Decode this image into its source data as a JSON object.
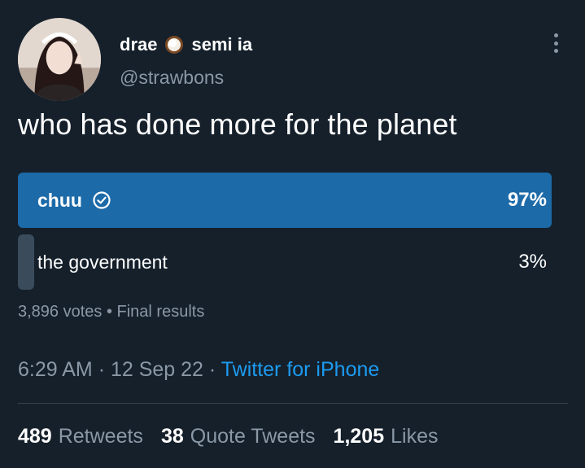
{
  "author": {
    "display_name_first": "drae",
    "display_name_second": "semi ia",
    "emoji_icon": "coconut-icon",
    "handle": "@strawbons"
  },
  "tweet": {
    "text": "who has done more for the planet"
  },
  "poll": {
    "options": [
      {
        "label": "chuu",
        "percent_text": "97%",
        "percent": 97,
        "winner": true
      },
      {
        "label": "the government",
        "percent_text": "3%",
        "percent": 3,
        "winner": false
      }
    ],
    "meta": "3,896 votes • Final results"
  },
  "timestamp": {
    "time": "6:29 AM",
    "sep1": "·",
    "date": "12 Sep 22",
    "sep2": "·",
    "source": "Twitter for iPhone"
  },
  "stats": {
    "retweets_count": "489",
    "retweets_label": "Retweets",
    "quotes_count": "38",
    "quotes_label": "Quote Tweets",
    "likes_count": "1,205",
    "likes_label": "Likes"
  },
  "colors": {
    "background": "#15202b",
    "accent": "#1d9bf0",
    "winner_bar": "#1d6aa8",
    "loser_bar": "#3a4c5c",
    "muted_text": "#8b98a5"
  }
}
